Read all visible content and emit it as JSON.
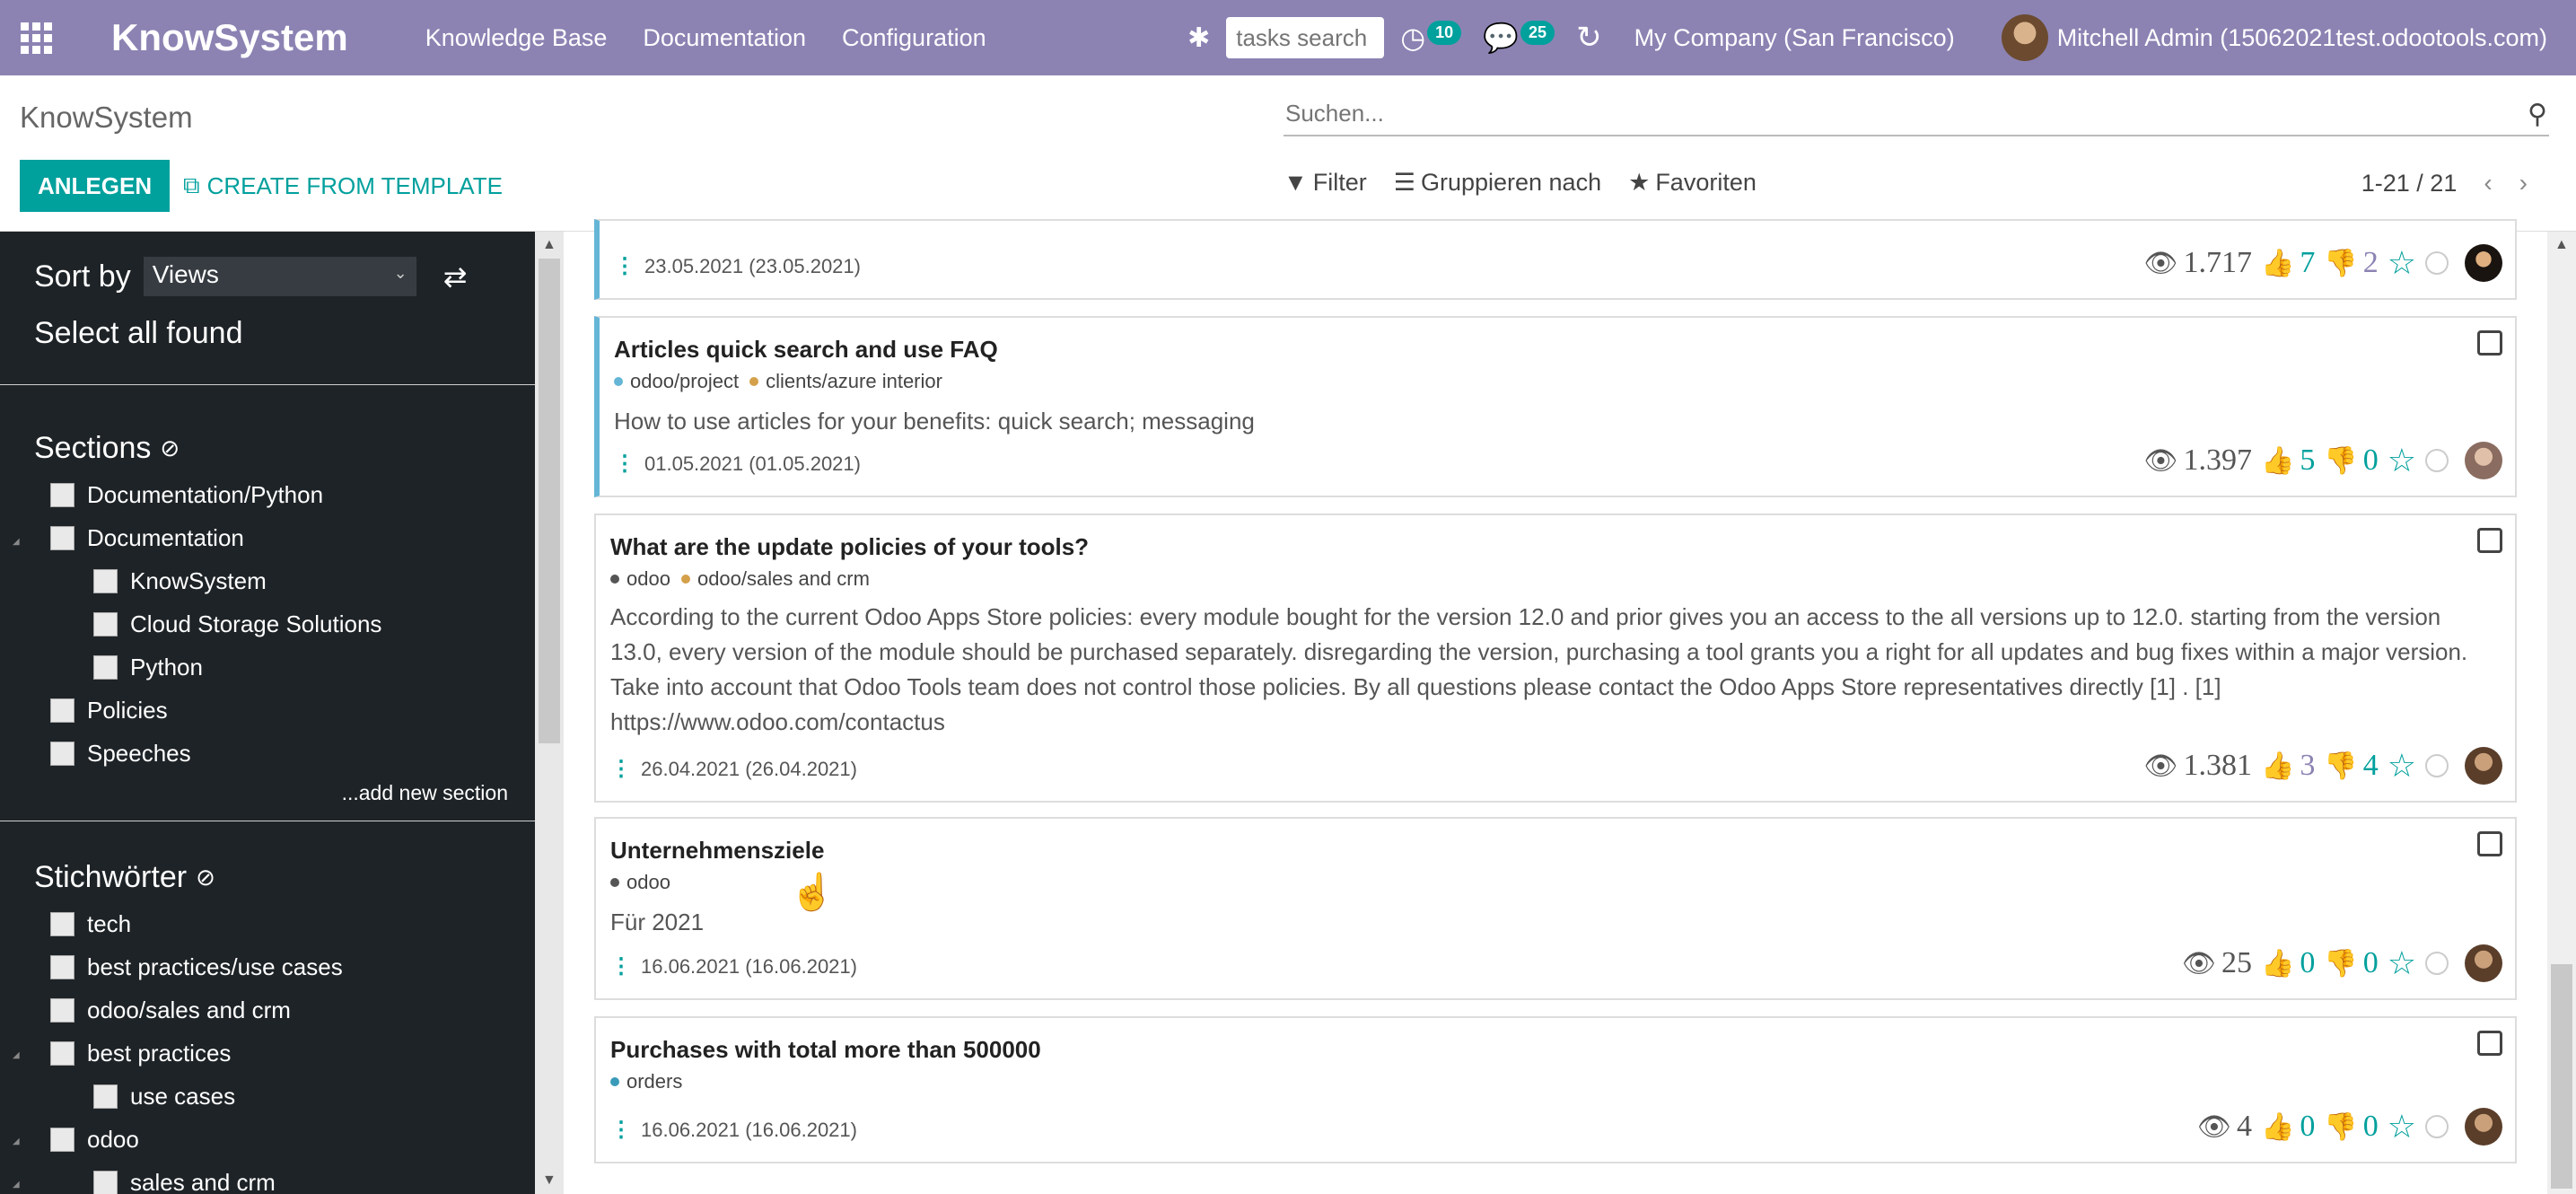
{
  "navbar": {
    "brand": "KnowSystem",
    "menus": [
      "Knowledge Base",
      "Documentation",
      "Configuration"
    ],
    "tasks_search_placeholder": "tasks search",
    "activity_count": "10",
    "messages_count": "25",
    "company": "My Company (San Francisco)",
    "user": "Mitchell Admin (15062021test.odootools.com)"
  },
  "control": {
    "breadcrumb": "KnowSystem",
    "search_placeholder": "Suchen...",
    "create_label": "ANLEGEN",
    "template_label": "CREATE FROM TEMPLATE",
    "filter_label": "Filter",
    "group_label": "Gruppieren nach",
    "favorites_label": "Favoriten",
    "pager": "1-21 / 21"
  },
  "sidebar": {
    "sort_by_label": "Sort by",
    "sort_value": "Views",
    "select_all": "Select all found",
    "sections_title": "Sections",
    "sections": [
      "Documentation/Python",
      "Documentation",
      "KnowSystem",
      "Cloud Storage Solutions",
      "Python",
      "Policies",
      "Speeches"
    ],
    "add_section": "...add new section",
    "tags_title": "Stichwörter",
    "tags": [
      "tech",
      "best practices/use cases",
      "odoo/sales and crm",
      "best practices",
      "use cases",
      "odoo",
      "sales and crm"
    ]
  },
  "articles": [
    {
      "title": "",
      "tags": [],
      "summary": "",
      "date": "23.05.2021 (23.05.2021)",
      "views": "1.717",
      "likes": "7",
      "dislikes": "2"
    },
    {
      "title": "Articles quick search and use FAQ",
      "tags": [
        {
          "name": "odoo/project",
          "color": "#64b5d6"
        },
        {
          "name": "clients/azure interior",
          "color": "#d4a04a"
        }
      ],
      "summary": "How to use articles for your benefits: quick search; messaging",
      "date": "01.05.2021 (01.05.2021)",
      "views": "1.397",
      "likes": "5",
      "dislikes": "0"
    },
    {
      "title": "What are the update policies of your tools?",
      "tags": [
        {
          "name": "odoo",
          "color": "#555555"
        },
        {
          "name": "odoo/sales and crm",
          "color": "#d4a04a"
        }
      ],
      "summary": "According to the current Odoo Apps Store policies: every module bought for the version 12.0 and prior gives you an access to the all versions up to 12.0. starting from the version 13.0, every version of the module should be purchased separately. disregarding the version, purchasing a tool grants you a right for all updates and bug fixes within a major version. Take into account that Odoo Tools team does not control those policies. By all questions please contact the Odoo Apps Store representatives directly [1] . [1] https://www.odoo.com/contactus",
      "date": "26.04.2021 (26.04.2021)",
      "views": "1.381",
      "likes": "3",
      "dislikes": "4"
    },
    {
      "title": "Unternehmensziele",
      "tags": [
        {
          "name": "odoo",
          "color": "#555555"
        }
      ],
      "summary": "Für 2021",
      "date": "16.06.2021 (16.06.2021)",
      "views": "25",
      "likes": "0",
      "dislikes": "0"
    },
    {
      "title": "Purchases with total more than 500000",
      "tags": [
        {
          "name": "orders",
          "color": "#3a9bb8"
        }
      ],
      "summary": "",
      "date": "16.06.2021 (16.06.2021)",
      "views": "4",
      "likes": "0",
      "dislikes": "0"
    }
  ],
  "colors": {
    "navbar": "#8c83b3",
    "accent": "#00a09d",
    "sidebar": "#1e2327"
  }
}
